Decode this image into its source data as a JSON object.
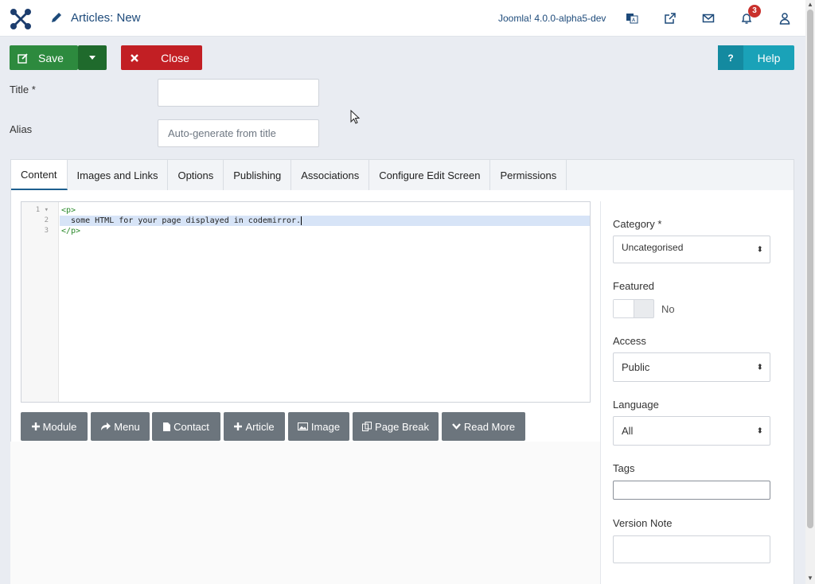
{
  "header": {
    "title": "Articles: New",
    "version_link": "Joomla! 4.0.0-alpha5-dev",
    "notification_count": "3",
    "icons": [
      "joomla-logo-icon",
      "pencil-icon",
      "multilingual-icon",
      "external-link-icon",
      "mail-icon",
      "bell-icon",
      "user-icon"
    ]
  },
  "toolbar": {
    "save_label": "Save",
    "close_label": "Close",
    "help_label": "Help",
    "help_icon_text": "?"
  },
  "form": {
    "title_label": "Title *",
    "title_value": "",
    "alias_label": "Alias",
    "alias_placeholder": "Auto-generate from title"
  },
  "tabs": [
    "Content",
    "Images and Links",
    "Options",
    "Publishing",
    "Associations",
    "Configure Edit Screen",
    "Permissions"
  ],
  "active_tab": "Content",
  "editor": {
    "line_numbers": [
      "1",
      "2",
      "3"
    ],
    "line1_marker": "▾",
    "line1": "<p>",
    "line2": "  some HTML for your page displayed in codemirror.",
    "line3": "</p>"
  },
  "editor_buttons": [
    "Module",
    "Menu",
    "Contact",
    "Article",
    "Image",
    "Page Break",
    "Read More"
  ],
  "sidebar": {
    "category_label": "Category *",
    "category_value": "Uncategorised",
    "featured_label": "Featured",
    "featured_value": "No",
    "access_label": "Access",
    "access_value": "Public",
    "language_label": "Language",
    "language_value": "All",
    "tags_label": "Tags",
    "tags_value": "",
    "version_note_label": "Version Note",
    "version_note_value": ""
  },
  "colors": {
    "save": "#2d8a3e",
    "close": "#c21f24",
    "help": "#1aa2b8",
    "editor_button": "#6c757d",
    "link": "#1d4a7a"
  }
}
